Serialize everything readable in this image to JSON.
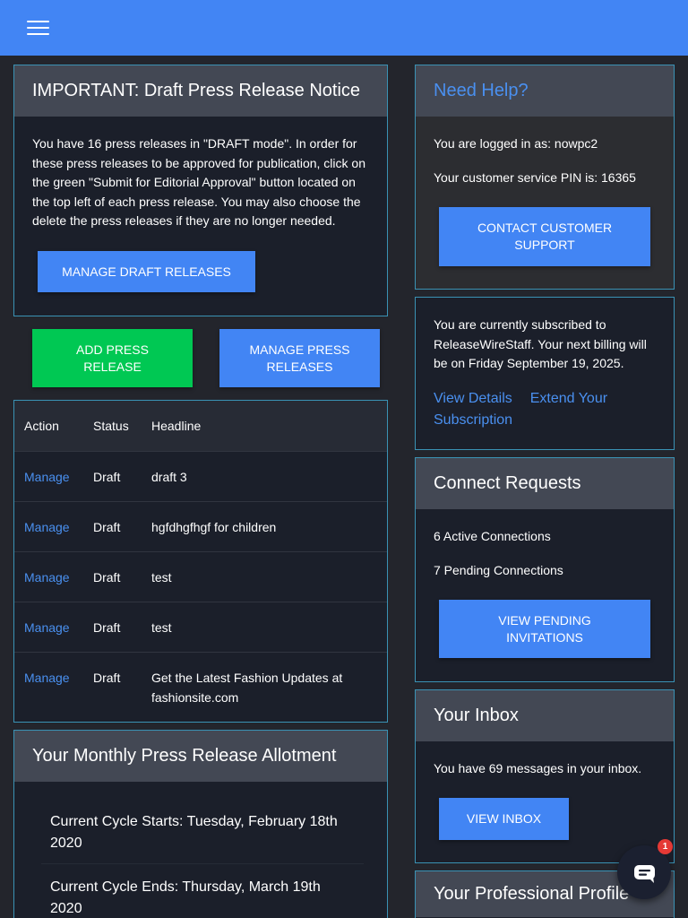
{
  "header": {
    "menu_icon": "hamburger-menu-icon",
    "color": "#4285f4"
  },
  "draft_notice": {
    "title": "IMPORTANT: Draft Press Release Notice",
    "body": "You have 16 press releases in \"DRAFT mode\". In order for these press releases to be approved for publication, click on the green \"Submit for Editorial Approval\" button located on the top left of each press release. You may also choose the delete the press releases if they are no longer needed.",
    "manage_button": "MANAGE DRAFT RELEASES"
  },
  "actions": {
    "add_button": "ADD PRESS RELEASE",
    "manage_button": "MANAGE PRESS RELEASES"
  },
  "releases_table": {
    "headers": [
      "Action",
      "Status",
      "Headline"
    ],
    "rows": [
      {
        "action": "Manage",
        "status": "Draft",
        "headline": "draft 3"
      },
      {
        "action": "Manage",
        "status": "Draft",
        "headline": "hgfdhgfhgf for children"
      },
      {
        "action": "Manage",
        "status": "Draft",
        "headline": "test"
      },
      {
        "action": "Manage",
        "status": "Draft",
        "headline": "test"
      },
      {
        "action": "Manage",
        "status": "Draft",
        "headline": "Get the Latest Fashion Updates at fashionsite.com"
      }
    ]
  },
  "allotment": {
    "title": "Your Monthly Press Release Allotment",
    "cycle_start": "Current Cycle Starts: Tuesday, February 18th 2020",
    "cycle_end": "Current Cycle Ends: Thursday, March 19th 2020"
  },
  "help": {
    "title": "Need Help?",
    "logged_in": "You are logged in as: nowpc2",
    "pin": "Your customer service PIN is: 16365",
    "contact_button": "CONTACT CUSTOMER SUPPORT"
  },
  "subscription": {
    "text": "You are currently subscribed to ReleaseWireStaff. Your next billing will be on Friday September 19, 2025.",
    "view_details": "View Details",
    "extend": "Extend Your Subscription"
  },
  "connect": {
    "title": "Connect Requests",
    "active": "6 Active Connections",
    "pending": "7 Pending Connections",
    "button": "VIEW PENDING INVITATIONS"
  },
  "inbox": {
    "title": "Your Inbox",
    "text": "You have 69 messages in your inbox.",
    "button": "VIEW INBOX"
  },
  "profile": {
    "title": "Your Professional Profile"
  },
  "chat": {
    "icon": "chat-bubble-icon",
    "badge": "1"
  }
}
